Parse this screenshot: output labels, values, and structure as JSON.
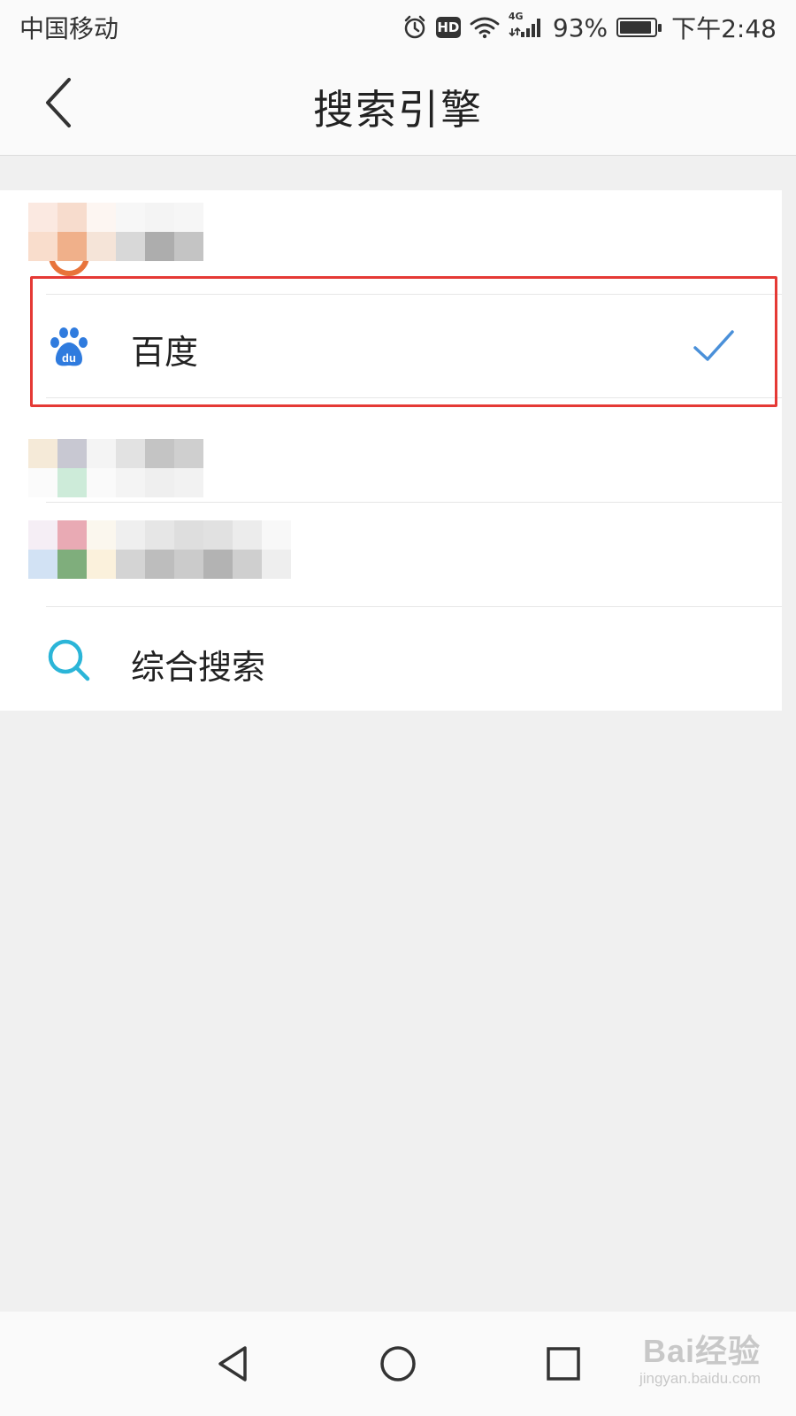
{
  "status_bar": {
    "carrier": "中国移动",
    "network": "4G",
    "battery_percent": "93%",
    "battery_level": 0.93,
    "time": "下午2:48",
    "icons": [
      "alarm-icon",
      "hd-icon",
      "wifi-icon",
      "signal-icon",
      "battery-icon"
    ],
    "hd_label": "HD"
  },
  "header": {
    "title": "搜索引擎",
    "back_icon": "chevron-left-icon"
  },
  "engines": {
    "items": [
      {
        "label": "",
        "icon": "sogou-icon",
        "blurred": true,
        "selected": false
      },
      {
        "label": "百度",
        "icon": "baidu-paw-icon",
        "icon_text": "du",
        "blurred": false,
        "selected": true
      },
      {
        "label": "",
        "icon": "engine-icon",
        "blurred": true,
        "selected": false
      },
      {
        "label": "",
        "icon": "engine-icon",
        "blurred": true,
        "selected": false
      },
      {
        "label": "综合搜索",
        "icon": "search-icon",
        "blurred": false,
        "selected": false
      }
    ],
    "selected_icon": "checkmark-icon"
  },
  "colors": {
    "accent_blue": "#4a90d9",
    "baidu_blue": "#2f7bde",
    "search_cyan": "#2bb5d8",
    "highlight_red": "#e53935",
    "background": "#f0f0f0"
  },
  "nav_bar": {
    "buttons": [
      "back-triangle-icon",
      "home-circle-icon",
      "recents-square-icon"
    ]
  },
  "watermark": {
    "main": "Bai经验",
    "sub": "jingyan.baidu.com"
  }
}
